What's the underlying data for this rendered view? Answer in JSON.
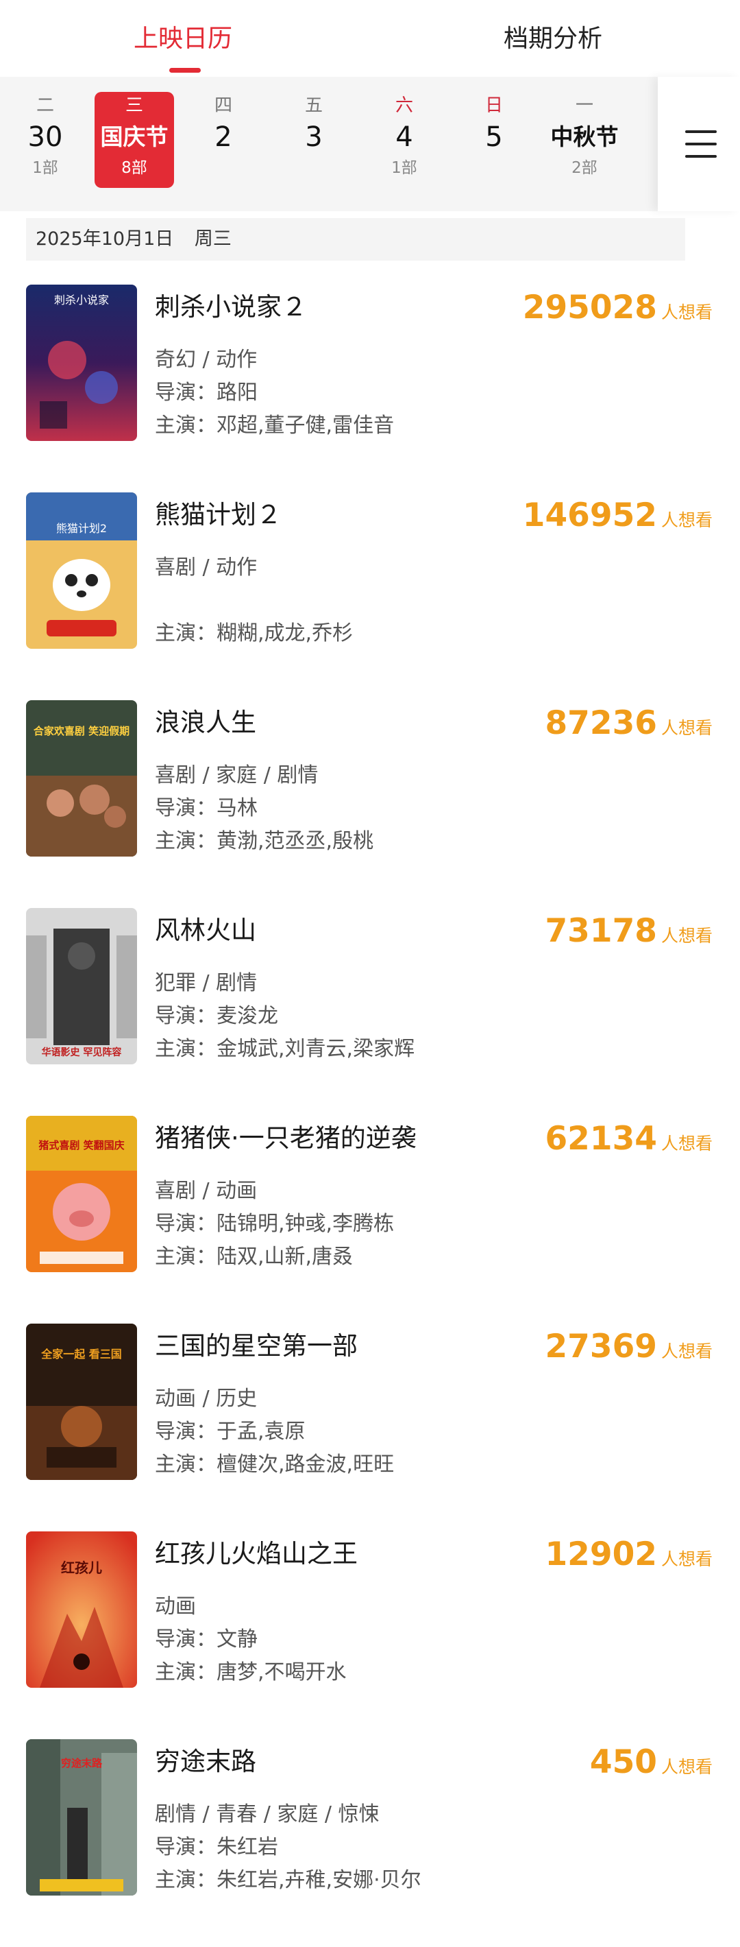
{
  "tabs": {
    "calendar": "上映日历",
    "analysis": "档期分析"
  },
  "dates": [
    {
      "weekday": "二",
      "day": "30",
      "count": "1部"
    },
    {
      "weekday": "三",
      "day": "国庆节",
      "count": "8部"
    },
    {
      "weekday": "四",
      "day": "2",
      "count": ""
    },
    {
      "weekday": "五",
      "day": "3",
      "count": ""
    },
    {
      "weekday": "六",
      "day": "4",
      "count": "1部"
    },
    {
      "weekday": "日",
      "day": "5",
      "count": ""
    },
    {
      "weekday": "一",
      "day": "中秋节",
      "count": "2部"
    }
  ],
  "date_header": {
    "date": "2025年10月1日",
    "weekday": "周三"
  },
  "want_unit": "人想看",
  "director_prefix": "导演：",
  "cast_prefix": "主演：",
  "movies": [
    {
      "title": "刺杀小说家２",
      "want": "295028",
      "genre": "奇幻 / 动作",
      "director": "路阳",
      "cast": "邓超,董子健,雷佳音",
      "poster_text": "刺杀小说家"
    },
    {
      "title": "熊猫计划２",
      "want": "146952",
      "genre": "喜剧 / 动作",
      "director": "",
      "cast": "糊糊,成龙,乔杉",
      "poster_text": "熊猫计划2"
    },
    {
      "title": "浪浪人生",
      "want": "87236",
      "genre": "喜剧 / 家庭 / 剧情",
      "director": "马林",
      "cast": "黄渤,范丞丞,殷桃",
      "poster_text": "合家欢喜剧 笑迎假期"
    },
    {
      "title": "风林火山",
      "want": "73178",
      "genre": "犯罪 / 剧情",
      "director": "麦浚龙",
      "cast": "金城武,刘青云,梁家辉",
      "poster_text": "华语影史 罕见阵容"
    },
    {
      "title": "猪猪侠·一只老猪的逆袭",
      "want": "62134",
      "genre": "喜剧 / 动画",
      "director": "陆锦明,钟彧,李腾栋",
      "cast": "陆双,山新,唐叒",
      "poster_text": "猪式喜剧 笑翻国庆"
    },
    {
      "title": "三国的星空第一部",
      "want": "27369",
      "genre": "动画 / 历史",
      "director": "于孟,袁原",
      "cast": "檀健次,路金波,旺旺",
      "poster_text": "全家一起 看三国"
    },
    {
      "title": "红孩儿火焰山之王",
      "want": "12902",
      "genre": "动画",
      "director": "文静",
      "cast": "唐梦,不喝开水",
      "poster_text": "红孩儿"
    },
    {
      "title": "穷途末路",
      "want": "450",
      "genre": "剧情 / 青春 / 家庭 / 惊悚",
      "director": "朱红岩",
      "cast": "朱红岩,卉稚,安娜·贝尔",
      "poster_text": "穷途末路"
    }
  ],
  "colors": {
    "accent_red": "#e32b35",
    "want_orange": "#f09c1a"
  }
}
